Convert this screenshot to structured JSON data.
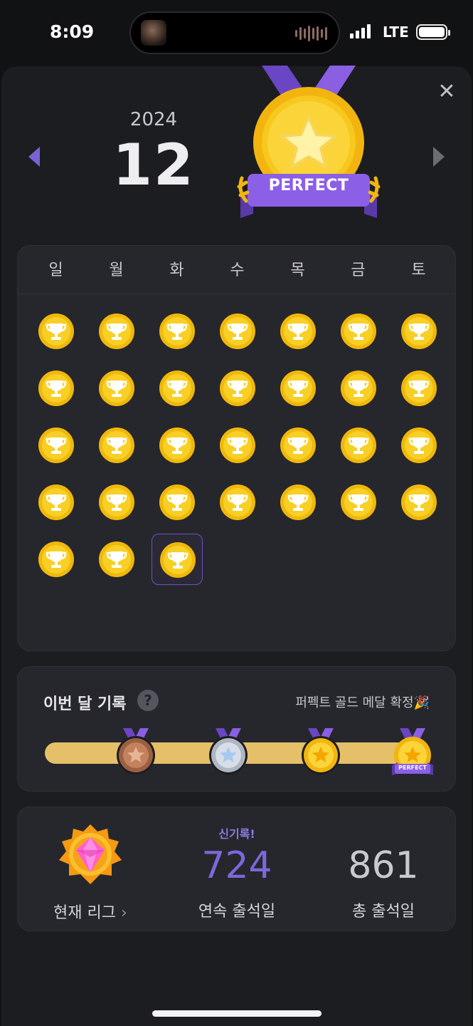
{
  "status_bar": {
    "time": "8:09",
    "network": "LTE",
    "icons": [
      "media-thumbnail-icon",
      "audio-wave-icon",
      "signal-icon",
      "battery-icon"
    ]
  },
  "header": {
    "year": "2024",
    "month": "12",
    "medal_label": "PERFECT",
    "icons": [
      "prev-month-arrow-icon",
      "next-month-arrow-icon",
      "close-icon"
    ]
  },
  "calendar": {
    "weekdays": [
      "일",
      "월",
      "화",
      "수",
      "목",
      "금",
      "토"
    ],
    "days_with_trophy": 31,
    "today_day": 31,
    "accent_color": "#f5c518"
  },
  "monthly_record": {
    "title": "이번 달 기록",
    "help_icon": "?",
    "status": "퍼펙트 골드 메달 확정🎉",
    "medals": [
      "bronze",
      "silver",
      "gold",
      "perfect"
    ],
    "perfect_tag": "PERFECT",
    "progress": 1.0
  },
  "stats": {
    "league_label": "현재 리그",
    "league_chevron": "›",
    "new_record_badge": "신기록!",
    "streak_value": "724",
    "streak_label": "연속 출석일",
    "total_value": "861",
    "total_label": "총 출석일"
  }
}
